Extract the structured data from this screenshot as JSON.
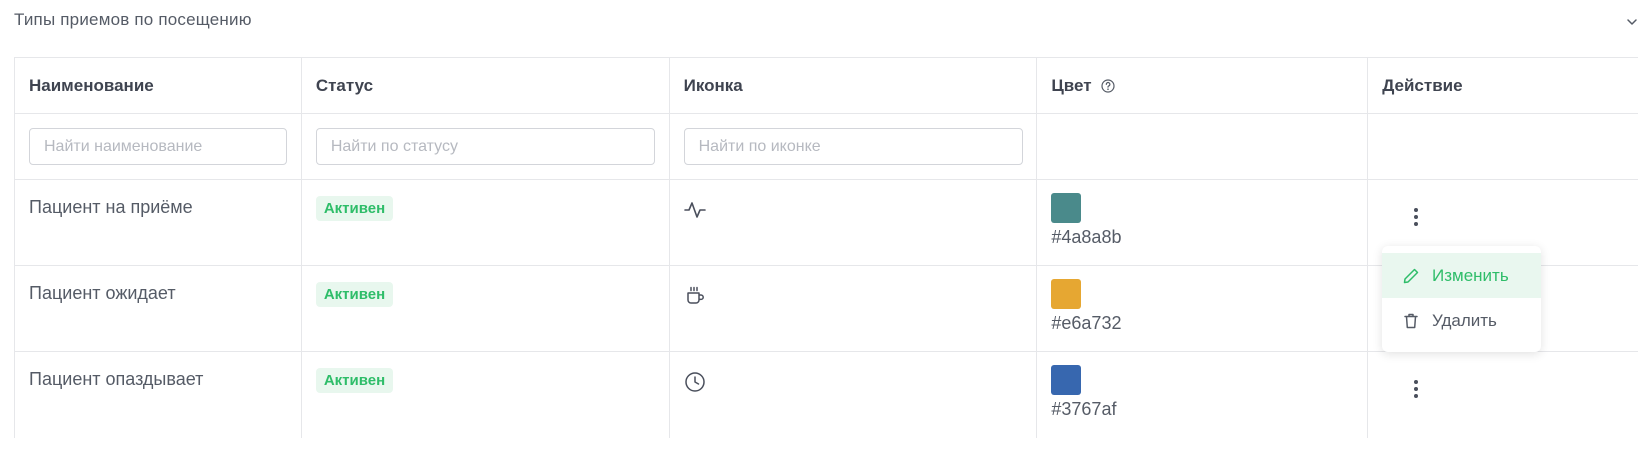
{
  "section": {
    "title": "Типы приемов по посещению",
    "collapse_icon": "chevron-down-icon"
  },
  "table": {
    "columns": [
      {
        "label": "Наименование"
      },
      {
        "label": "Статус"
      },
      {
        "label": "Иконка"
      },
      {
        "label": "Цвет",
        "help_icon": "question-circle-icon"
      },
      {
        "label": "Действие"
      }
    ],
    "filters": {
      "name_placeholder": "Найти наименование",
      "status_placeholder": "Найти по статусу",
      "icon_placeholder": "Найти по иконке"
    },
    "rows": [
      {
        "name": "Пациент на приёме",
        "status": "Активен",
        "icon": "activity-pulse-icon",
        "color": "#4a8a8b"
      },
      {
        "name": "Пациент ожидает",
        "status": "Активен",
        "icon": "coffee-cup-icon",
        "color": "#e6a732"
      },
      {
        "name": "Пациент опаздывает",
        "status": "Активен",
        "icon": "clock-icon",
        "color": "#3767af"
      }
    ]
  },
  "action_menu": {
    "items": [
      {
        "label": "Изменить",
        "icon": "pencil-icon"
      },
      {
        "label": "Удалить",
        "icon": "trash-icon"
      }
    ]
  },
  "colors": {
    "accent_green": "#2ebd69",
    "badge_bg": "#e8f7ee",
    "border": "#e6e7ea",
    "text": "#555b66"
  }
}
